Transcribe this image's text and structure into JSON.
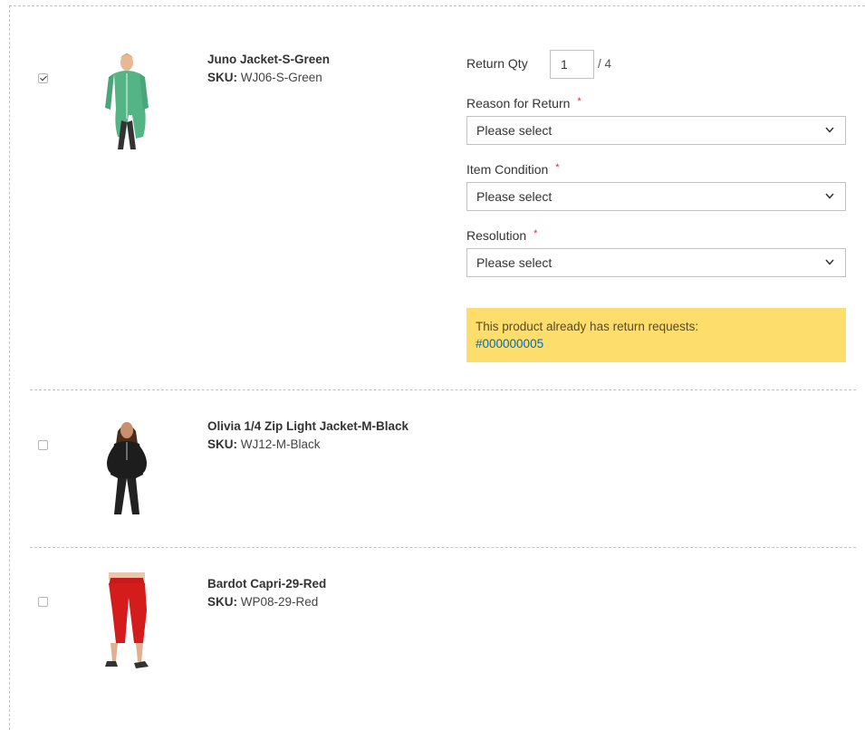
{
  "form_labels": {
    "return_qty": "Return Qty",
    "reason": "Reason for Return",
    "condition": "Item Condition",
    "resolution": "Resolution",
    "required_marker": "*"
  },
  "items": [
    {
      "checked": true,
      "name": "Juno Jacket-S-Green",
      "sku_label": "SKU:",
      "sku": "WJ06-S-Green",
      "image_icon": "green-jacket-photo"
    },
    {
      "checked": false,
      "name": "Olivia 1/4 Zip Light Jacket-M-Black",
      "sku_label": "SKU:",
      "sku": "WJ12-M-Black",
      "image_icon": "black-jacket-photo"
    },
    {
      "checked": false,
      "name": "Bardot Capri-29-Red",
      "sku_label": "SKU:",
      "sku": "WP08-29-Red",
      "image_icon": "red-capri-photo"
    }
  ],
  "return_form": {
    "qty_value": "1",
    "qty_max_text": "/ 4",
    "reason_value": "Please select",
    "condition_value": "Please select",
    "resolution_value": "Please select"
  },
  "notice": {
    "text": "This product already has return requests:",
    "link": "#000000005",
    "bg_color": "#fdde6c"
  },
  "colors": {
    "required": "#e02b27",
    "link": "#006bb4",
    "border": "#c2c2c2"
  }
}
